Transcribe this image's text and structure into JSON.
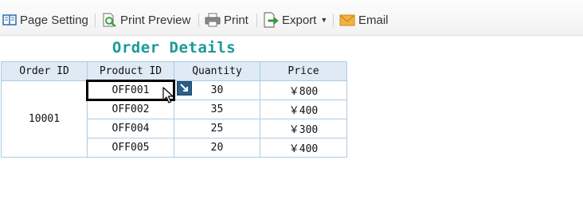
{
  "toolbar": {
    "page_setting": "Page Setting",
    "print_preview": "Print Preview",
    "print": "Print",
    "export": "Export",
    "email": "Email"
  },
  "report": {
    "title": "Order Details",
    "columns": [
      "Order ID",
      "Product ID",
      "Quantity",
      "Price"
    ],
    "order_id": "10001",
    "rows": [
      {
        "product": "OFF001",
        "qty": "30",
        "price": "￥800"
      },
      {
        "product": "OFF002",
        "qty": "35",
        "price": "￥400"
      },
      {
        "product": "OFF004",
        "qty": "25",
        "price": "￥300"
      },
      {
        "product": "OFF005",
        "qty": "20",
        "price": "￥400"
      }
    ]
  },
  "icons": {
    "page_setting": "page-setting-icon",
    "print_preview": "print-preview-icon",
    "print": "printer-icon",
    "export": "export-icon",
    "email": "email-icon",
    "expand": "expand-arrow-icon",
    "cursor": "mouse-cursor-icon"
  },
  "colors": {
    "title": "#1a9a9a",
    "header_bg": "#dfeaf5",
    "grid_border": "#a9cde3",
    "selection": "#000000"
  }
}
